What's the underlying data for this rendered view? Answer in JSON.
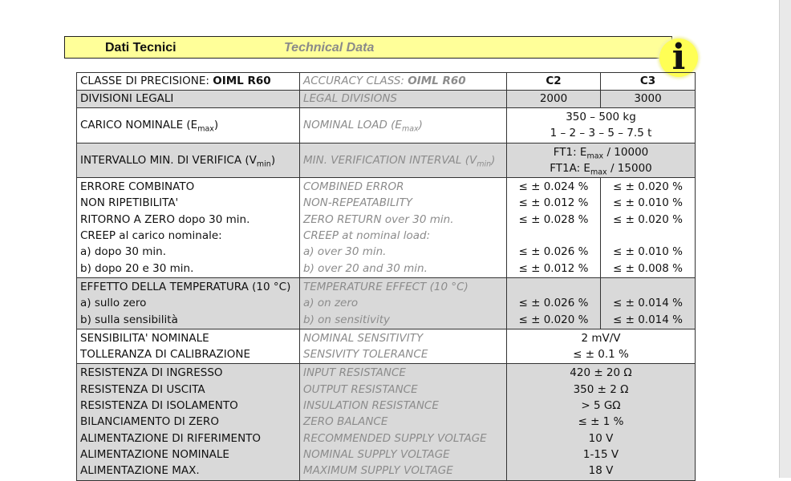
{
  "header": {
    "it": "Dati Tecnici",
    "en": "Technical Data",
    "info_icon": "i"
  },
  "rows": {
    "accuracy": {
      "it_pre": "CLASSE DI PRECISIONE: ",
      "it_bold": "OIML R60",
      "en_pre": "ACCURACY CLASS: ",
      "en_bold": "OIML R60",
      "c2": "C2",
      "c3": "C3"
    },
    "legal": {
      "it": "DIVISIONI LEGALI",
      "en": "LEGAL DIVISIONS",
      "c2": "2000",
      "c3": "3000"
    },
    "nominal": {
      "it_pre": "CARICO NOMINALE (E",
      "it_sub": "max",
      "it_post": ")",
      "en_pre": "NOMINAL LOAD (E",
      "en_sub": "max",
      "en_post": ")",
      "v1": "350 – 500 kg",
      "v2": "1 – 2 – 3 – 5 – 7.5 t"
    },
    "interval": {
      "it_pre": "INTERVALLO MIN. DI VERIFICA (V",
      "it_sub": "min",
      "it_post": ")",
      "en_pre": "MIN. VERIFICATION INTERVAL (V",
      "en_sub": "min",
      "en_post": ")",
      "v1_pre": "FT1: E",
      "v1_sub": "max",
      "v1_post": " / 10000",
      "v2_pre": "FT1A: E",
      "v2_sub": "max",
      "v2_post": " / 15000"
    },
    "errors": {
      "it": [
        "ERRORE COMBINATO",
        "NON RIPETIBILITA'",
        "RITORNO A ZERO dopo 30 min.",
        "CREEP al carico nominale:",
        "a) dopo 30 min.",
        "b) dopo 20 e 30 min."
      ],
      "en": [
        "COMBINED ERROR",
        "NON-REPEATABILITY",
        "ZERO RETURN over 30 min.",
        "CREEP at nominal load:",
        "a) over 30 min.",
        "b) over 20 and 30 min."
      ],
      "c2": [
        "≤ ± 0.024 %",
        "≤ ± 0.012 %",
        "≤ ± 0.028 %",
        "",
        "≤ ± 0.026 %",
        "≤ ± 0.012 %"
      ],
      "c3": [
        "≤ ± 0.020 %",
        "≤ ± 0.010 %",
        "≤ ± 0.020 %",
        "",
        "≤ ± 0.010 %",
        "≤ ± 0.008 %"
      ]
    },
    "temperature": {
      "it": [
        "EFFETTO DELLA TEMPERATURA (10 °C)",
        "a) sullo zero",
        "b) sulla sensibilità"
      ],
      "en": [
        "TEMPERATURE EFFECT (10 °C)",
        "a) on zero",
        "b) on sensitivity"
      ],
      "c2": [
        "",
        "≤ ± 0.026 %",
        "≤ ± 0.020 %"
      ],
      "c3": [
        "",
        "≤ ± 0.014 %",
        "≤ ± 0.014 %"
      ]
    },
    "sensitivity": {
      "it": [
        "SENSIBILITA' NOMINALE",
        "TOLLERANZA DI CALIBRAZIONE"
      ],
      "en": [
        "NOMINAL SENSITIVITY",
        "SENSIVITY TOLERANCE"
      ],
      "val": [
        "2 mV/V",
        "≤ ± 0.1 %"
      ]
    },
    "electrical": {
      "it": [
        "RESISTENZA DI INGRESSO",
        "RESISTENZA DI USCITA",
        "RESISTENZA DI ISOLAMENTO",
        "BILANCIAMENTO DI ZERO",
        "ALIMENTAZIONE DI RIFERIMENTO",
        "ALIMENTAZIONE NOMINALE",
        "ALIMENTAZIONE MAX."
      ],
      "en": [
        "INPUT RESISTANCE",
        "OUTPUT RESISTANCE",
        "INSULATION RESISTANCE",
        "ZERO BALANCE",
        "RECOMMENDED SUPPLY VOLTAGE",
        "NOMINAL SUPPLY VOLTAGE",
        "MAXIMUM SUPPLY VOLTAGE"
      ],
      "val": [
        "420 ± 20 Ω",
        "350 ± 2 Ω",
        "> 5 GΩ",
        "≤ ± 1 %",
        "10 V",
        "1-15 V",
        "18 V"
      ]
    }
  }
}
